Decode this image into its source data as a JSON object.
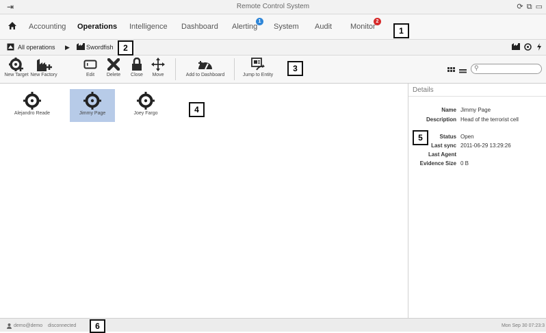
{
  "window": {
    "title": "Remote Control System",
    "controls": "⟳ ⧉ ▭"
  },
  "menu": {
    "items": [
      {
        "label": "Accounting"
      },
      {
        "label": "Operations"
      },
      {
        "label": "Intelligence"
      },
      {
        "label": "Dashboard"
      },
      {
        "label": "Alerting",
        "badge": "1"
      },
      {
        "label": "System"
      },
      {
        "label": "Audit"
      },
      {
        "label": "Monitor",
        "badge": "2"
      }
    ],
    "badge_colors": {
      "alerting": "#2f86d8",
      "monitor": "#d62a2a"
    }
  },
  "breadcrumb": {
    "root": "All operations",
    "separator": "▶",
    "current": "Swordfish"
  },
  "toolbar": {
    "buttons": [
      {
        "label": "New Target"
      },
      {
        "label": "New Factory"
      },
      {
        "label": "Edit"
      },
      {
        "label": "Delete"
      },
      {
        "label": "Close"
      },
      {
        "label": "Move"
      },
      {
        "label": "Add to Dashboard"
      },
      {
        "label": "Jump to Entity"
      }
    ],
    "search_placeholder": ""
  },
  "entities": [
    {
      "name": "Alejandro Reade"
    },
    {
      "name": "Jimmy Page",
      "selected": true
    },
    {
      "name": "Joey Fargo"
    }
  ],
  "details": {
    "title": "Details",
    "rows": [
      {
        "key": "Name",
        "value": "Jimmy Page"
      },
      {
        "key": "Description",
        "value": "Head of the terrorist cell"
      },
      {
        "key": "Status",
        "value": "Open"
      },
      {
        "key": "Last sync",
        "value": "2011-06-29 13:29:26"
      },
      {
        "key": "Last Agent",
        "value": ""
      },
      {
        "key": "Evidence Size",
        "value": "0 B"
      }
    ]
  },
  "status": {
    "user": "demo@demo",
    "connection": "disconnected",
    "datetime": "Mon Sep 30  07:23:3"
  },
  "callouts": [
    "1",
    "2",
    "3",
    "4",
    "5",
    "6"
  ],
  "colors": {
    "selection": "#b7cbe8"
  }
}
